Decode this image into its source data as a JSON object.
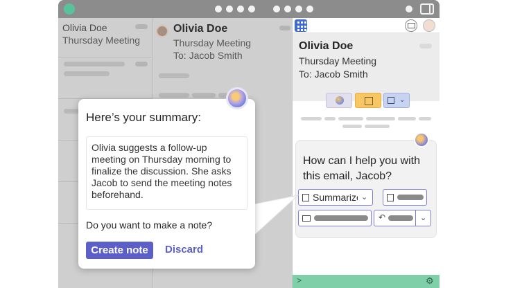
{
  "list": {
    "first_item": {
      "sender": "Olivia Doe",
      "subject": "Thursday Meeting"
    }
  },
  "reader": {
    "sender": "Olivia Doe",
    "subject": "Thursday Meeting",
    "to": "To: Jacob Smith"
  },
  "side_panel": {
    "sender": "Olivia Doe",
    "subject": "Thursday Meeting",
    "to": "To: Jacob Smith",
    "prompt": "How can I help you with this email, Jacob?",
    "summarize_label": "Summarize",
    "footer_color": "#7fcfa9"
  },
  "popup": {
    "title": "Here’s your summary:",
    "summary": "Olivia suggests a follow-up meeting on Thursday morning to finalize the discussion. She asks Jacob to send the meeting notes beforehand.",
    "question": "Do you want to make a note?",
    "create_label": "Create note",
    "discard_label": "Discard",
    "accent": "#5b5fc7"
  },
  "icons": [
    "app-logo-icon",
    "grid-icon",
    "mail-icon",
    "copilot-icon",
    "checklist-icon",
    "settings-gear-icon",
    "chevron-down-icon",
    "chevron-right-icon",
    "undo-icon",
    "contact-card-icon",
    "document-icon"
  ]
}
